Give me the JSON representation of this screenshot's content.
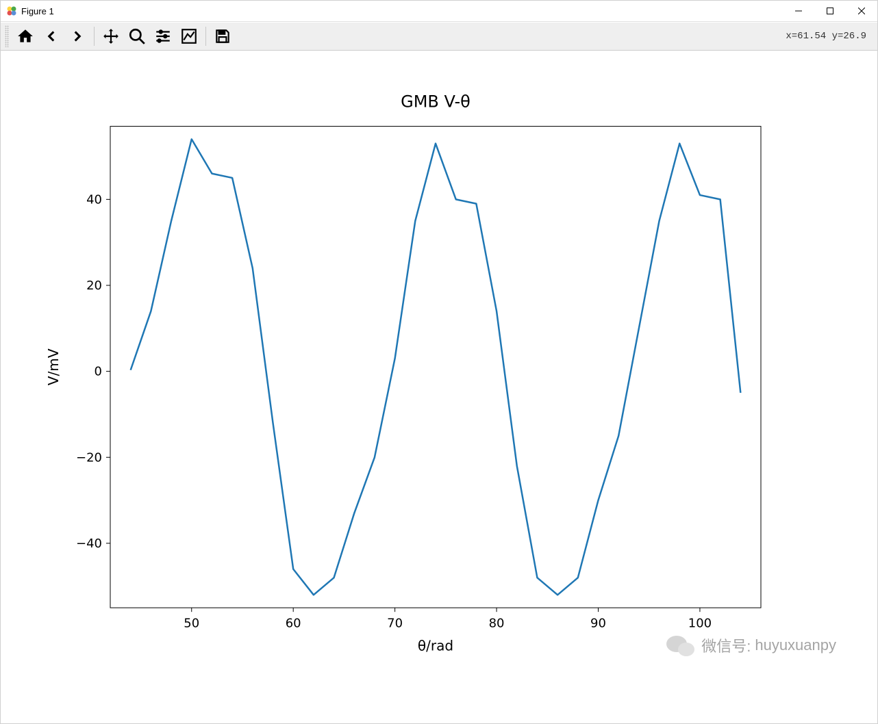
{
  "window": {
    "title": "Figure 1"
  },
  "toolbar": {
    "status": "x=61.54 y=26.9"
  },
  "chart_data": {
    "type": "line",
    "title": "GMB V-θ",
    "xlabel": "θ/rad",
    "ylabel": "V/mV",
    "xlim": [
      42,
      106
    ],
    "ylim": [
      -55,
      57
    ],
    "xticks": [
      50,
      60,
      70,
      80,
      90,
      100
    ],
    "yticks": [
      -40,
      -20,
      0,
      20,
      40
    ],
    "x": [
      44,
      46,
      48,
      50,
      52,
      54,
      56,
      58,
      60,
      62,
      64,
      66,
      68,
      70,
      72,
      74,
      76,
      78,
      80,
      82,
      84,
      86,
      88,
      90,
      92,
      94,
      96,
      98,
      100,
      102,
      104
    ],
    "y": [
      0.3,
      14,
      35,
      54,
      46,
      45,
      24,
      -12,
      -46,
      -52,
      -48,
      -33,
      -20,
      3,
      35,
      53,
      40,
      39,
      14,
      -22,
      -48,
      -52,
      -48,
      -30,
      -15,
      10,
      35,
      53,
      41,
      40,
      -5
    ],
    "series_color": "#1f77b4"
  },
  "watermark": {
    "prefix": "微信号:",
    "id": "huyuxuanpy"
  }
}
